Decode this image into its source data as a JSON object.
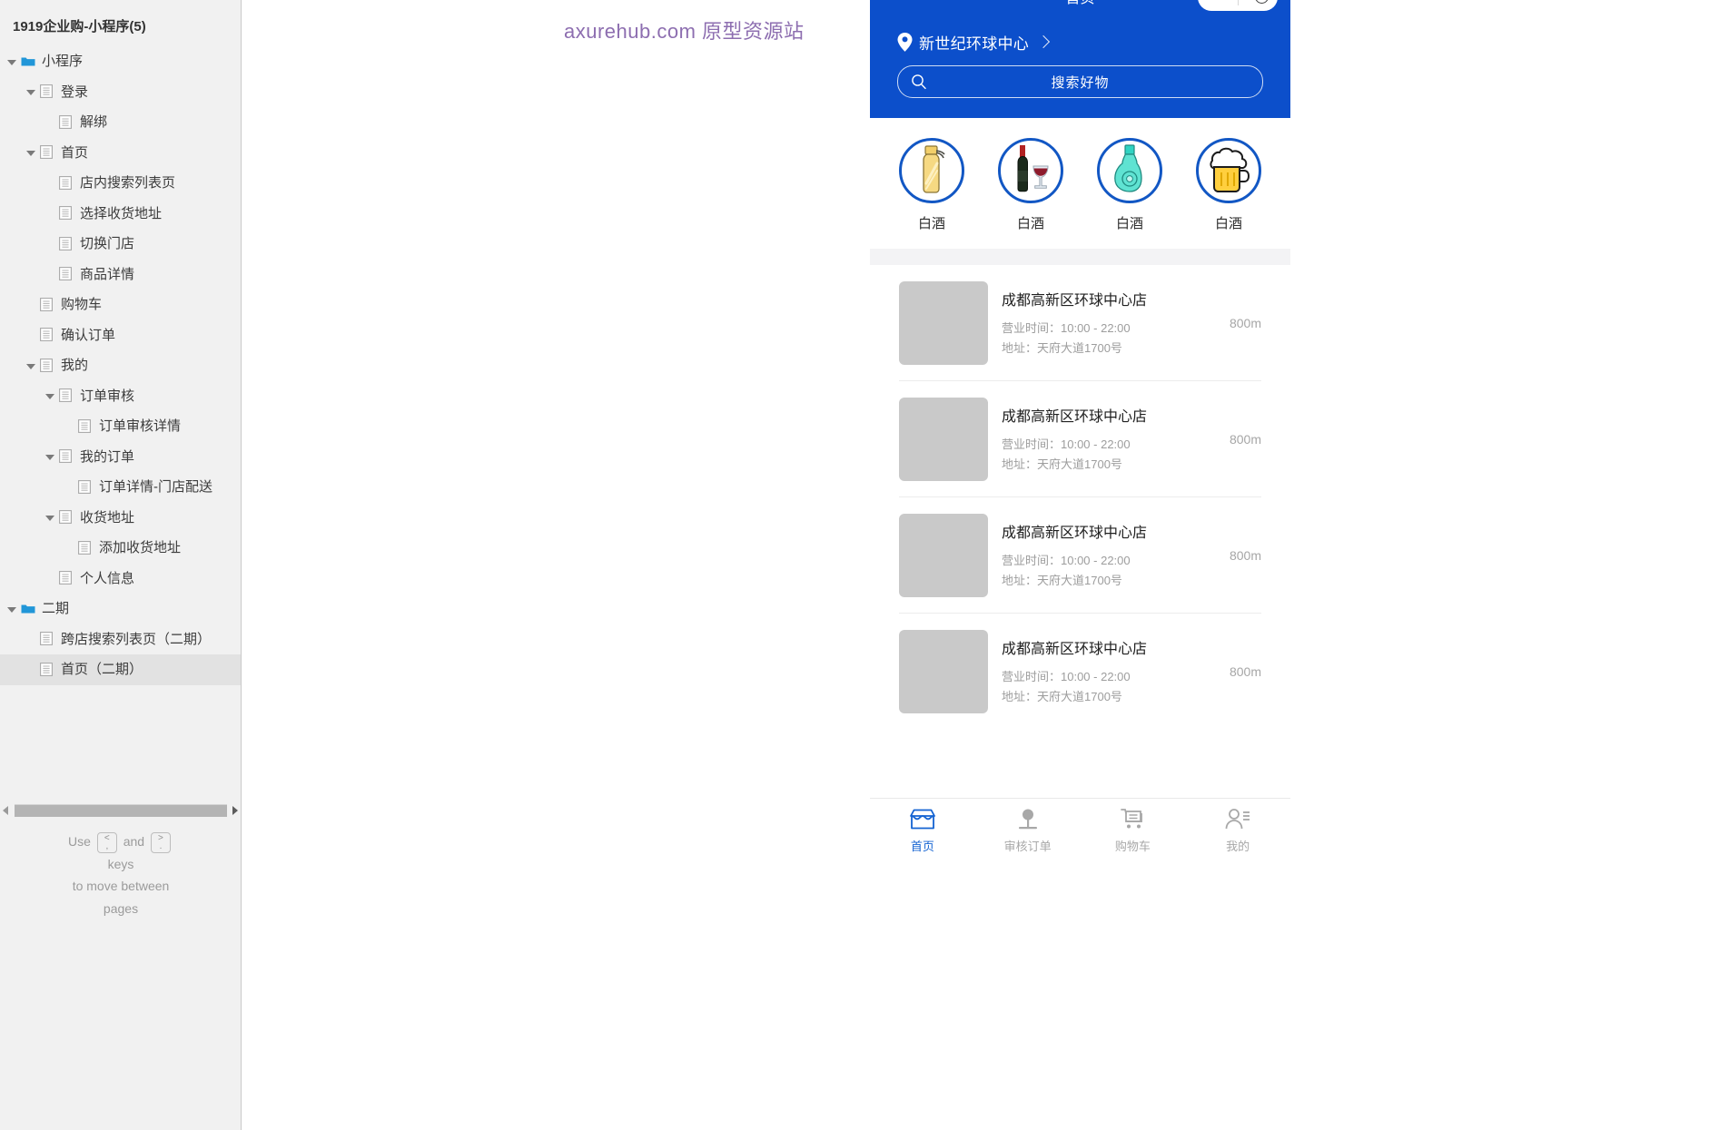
{
  "sidebar": {
    "title": "1919企业购-小程序(5)",
    "tree": [
      {
        "label": "小程序",
        "depth": 0,
        "icon": "folder-icon",
        "arrow": "open",
        "selected": false
      },
      {
        "label": "登录",
        "depth": 1,
        "icon": "page-icon",
        "arrow": "open",
        "selected": false
      },
      {
        "label": "解绑",
        "depth": 2,
        "icon": "page-icon",
        "arrow": "none",
        "selected": false
      },
      {
        "label": "首页",
        "depth": 1,
        "icon": "page-icon",
        "arrow": "open",
        "selected": false
      },
      {
        "label": "店内搜索列表页",
        "depth": 2,
        "icon": "page-icon",
        "arrow": "none",
        "selected": false
      },
      {
        "label": "选择收货地址",
        "depth": 2,
        "icon": "page-icon",
        "arrow": "none",
        "selected": false
      },
      {
        "label": "切换门店",
        "depth": 2,
        "icon": "page-icon",
        "arrow": "none",
        "selected": false
      },
      {
        "label": "商品详情",
        "depth": 2,
        "icon": "page-icon",
        "arrow": "none",
        "selected": false
      },
      {
        "label": "购物车",
        "depth": 1,
        "icon": "page-icon",
        "arrow": "none",
        "selected": false
      },
      {
        "label": "确认订单",
        "depth": 1,
        "icon": "page-icon",
        "arrow": "none",
        "selected": false
      },
      {
        "label": "我的",
        "depth": 1,
        "icon": "page-icon",
        "arrow": "open",
        "selected": false
      },
      {
        "label": "订单审核",
        "depth": 2,
        "icon": "page-icon",
        "arrow": "open",
        "selected": false
      },
      {
        "label": "订单审核详情",
        "depth": 3,
        "icon": "page-icon",
        "arrow": "none",
        "selected": false
      },
      {
        "label": "我的订单",
        "depth": 2,
        "icon": "page-icon",
        "arrow": "open",
        "selected": false
      },
      {
        "label": "订单详情-门店配送",
        "depth": 3,
        "icon": "page-icon",
        "arrow": "none",
        "selected": false
      },
      {
        "label": "收货地址",
        "depth": 2,
        "icon": "page-icon",
        "arrow": "open",
        "selected": false
      },
      {
        "label": "添加收货地址",
        "depth": 3,
        "icon": "page-icon",
        "arrow": "none",
        "selected": false
      },
      {
        "label": "个人信息",
        "depth": 2,
        "icon": "page-icon",
        "arrow": "none",
        "selected": false
      },
      {
        "label": "二期",
        "depth": 0,
        "icon": "folder-icon",
        "arrow": "open",
        "selected": false
      },
      {
        "label": "跨店搜索列表页（二期）",
        "depth": 1,
        "icon": "page-icon",
        "arrow": "none",
        "selected": false
      },
      {
        "label": "首页（二期）",
        "depth": 1,
        "icon": "page-icon",
        "arrow": "none",
        "selected": true
      }
    ],
    "help": {
      "line1_prefix": "Use",
      "key_prev_up": "<",
      "key_prev_dn": ",",
      "line1_mid": "and",
      "key_next_up": ">",
      "key_next_dn": ".",
      "line2": "keys",
      "line3": "to move between",
      "line4": "pages"
    }
  },
  "watermark": {
    "text": "axurehub.com 原型资源站",
    "color": "#8d6eb0"
  },
  "phone": {
    "nav_title": "首页",
    "theme_color": "#0c4fcb",
    "accent_color": "#1463d2",
    "header": {
      "location": "新世纪环球中心",
      "location_icon": "map-pin-icon",
      "chevron_icon": "chevron-right-icon",
      "search_icon": "search-icon",
      "search_placeholder": "搜索好物"
    },
    "categories": [
      {
        "label": "白酒",
        "icon": "liquor-bottle-icon"
      },
      {
        "label": "白酒",
        "icon": "wine-bottle-glass-icon"
      },
      {
        "label": "白酒",
        "icon": "green-flask-icon"
      },
      {
        "label": "白酒",
        "icon": "beer-mug-icon"
      }
    ],
    "stores": [
      {
        "name": "成都高新区环球中心店",
        "hours": "营业时间：10:00 - 22:00",
        "address": "地址：天府大道1700号",
        "distance": "800m"
      },
      {
        "name": "成都高新区环球中心店",
        "hours": "营业时间：10:00 - 22:00",
        "address": "地址：天府大道1700号",
        "distance": "800m"
      },
      {
        "name": "成都高新区环球中心店",
        "hours": "营业时间：10:00 - 22:00",
        "address": "地址：天府大道1700号",
        "distance": "800m"
      },
      {
        "name": "成都高新区环球中心店",
        "hours": "营业时间：10:00 - 22:00",
        "address": "地址：天府大道1700号",
        "distance": "800m"
      }
    ],
    "tabs": [
      {
        "label": "首页",
        "icon": "storefront-icon",
        "active": true
      },
      {
        "label": "审核订单",
        "icon": "pin-stand-icon",
        "active": false
      },
      {
        "label": "购物车",
        "icon": "cart-icon",
        "active": false
      },
      {
        "label": "我的",
        "icon": "user-icon",
        "active": false
      }
    ]
  }
}
